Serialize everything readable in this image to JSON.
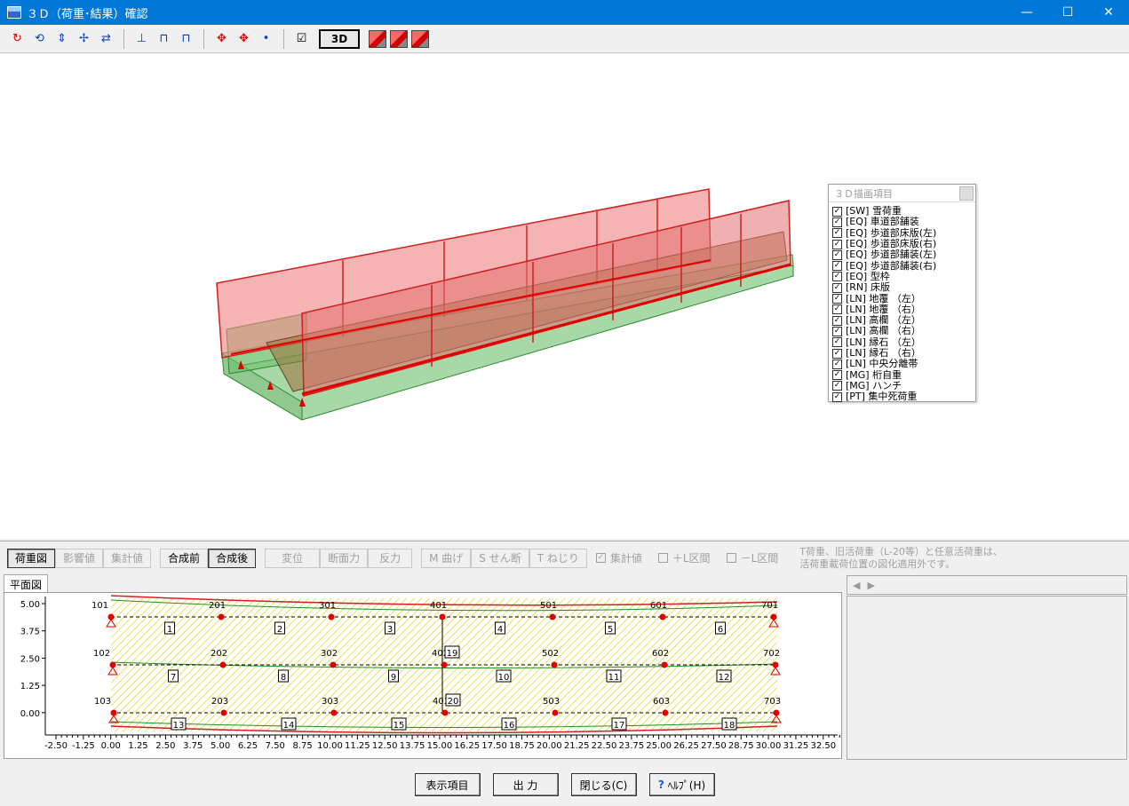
{
  "window": {
    "title": "３Ｄ（荷重･結果）確認",
    "min": "—",
    "max": "☐",
    "close": "✕"
  },
  "toolbar": {
    "rotate_icons": [
      "↻",
      "⟲",
      "⇕",
      "✢",
      "⇄"
    ],
    "view_icons": [
      "⊥",
      "⊓",
      "⊓"
    ],
    "move_icons": [
      "✥",
      "✥",
      "•"
    ],
    "check_icon": "☑",
    "mode_3d": "3D"
  },
  "legend": {
    "title": "３Ｄ描画項目",
    "items": [
      "[SW] 雪荷重",
      "[EQ] 車道部舗装",
      "[EQ] 歩道部床版(左)",
      "[EQ] 歩道部床版(右)",
      "[EQ] 歩道部舗装(左)",
      "[EQ] 歩道部舗装(右)",
      "[EQ] 型枠",
      "[RN] 床版",
      "[LN] 地覆 （左）",
      "[LN] 地覆 （右）",
      "[LN] 高欄 （左）",
      "[LN] 高欄 （右）",
      "[LN] 縁石 （左）",
      "[LN] 縁石 （右）",
      "[LN] 中央分離帯",
      "[MG] 桁自重",
      "[MG] ハンチ",
      "[PT] 集中死荷重"
    ]
  },
  "controls": {
    "group1": [
      "荷重図",
      "影響値",
      "集計値"
    ],
    "group2": [
      "合成前",
      "合成後"
    ],
    "group3": [
      "変位",
      "断面力",
      "反力"
    ],
    "group4": [
      "M 曲げ",
      "S せん断",
      "T ねじり"
    ],
    "chk_total": "集計値",
    "chk_plus": "＋L区間",
    "chk_minus": "－L区間",
    "note_line1": "T荷重、旧活荷重（L-20等）と任意活荷重は、",
    "note_line2": "活荷重載荷位置の図化適用外です。"
  },
  "plan": {
    "tab": "平面図",
    "y_ticks": [
      "5.00",
      "3.75",
      "2.50",
      "1.25",
      "0.00"
    ],
    "x_ticks": [
      "-2.50",
      "-1.25",
      "0.00",
      "1.25",
      "2.50",
      "3.75",
      "5.00",
      "6.25",
      "7.50",
      "8.75",
      "10.00",
      "11.25",
      "12.50",
      "13.75",
      "15.00",
      "16.25",
      "17.50",
      "18.75",
      "20.00",
      "21.25",
      "22.50",
      "23.75",
      "25.00",
      "26.25",
      "27.50",
      "28.75",
      "30.00",
      "31.25",
      "32.50"
    ],
    "row1_nodes": [
      "101",
      "201",
      "301",
      "401",
      "501",
      "601",
      "701"
    ],
    "row2_nodes": [
      "102",
      "202",
      "302",
      "402",
      "502",
      "602",
      "702"
    ],
    "row3_nodes": [
      "103",
      "203",
      "303",
      "403",
      "503",
      "603",
      "703"
    ],
    "row1_members": [
      "1",
      "2",
      "3",
      "4",
      "5",
      "6"
    ],
    "row2_members": [
      "7",
      "8",
      "9",
      "10",
      "11",
      "12"
    ],
    "row3_members": [
      "13",
      "14",
      "15",
      "16",
      "17",
      "18"
    ],
    "cross_members": [
      "19",
      "20"
    ]
  },
  "rpanel": {
    "prev": "◀",
    "next": "▶"
  },
  "footer": {
    "display_items": "表示項目",
    "output": "出 力",
    "close": "閉じる(C)",
    "help": "ﾍﾙﾌﾟ(H)",
    "help_icon": "?"
  }
}
